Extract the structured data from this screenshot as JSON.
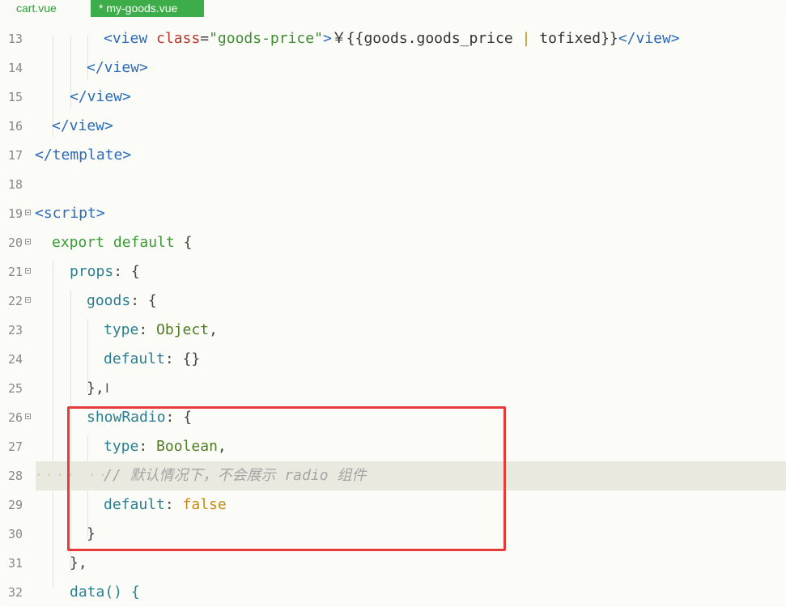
{
  "tabs": [
    {
      "label": "cart.vue",
      "active": false
    },
    {
      "label": "* my-goods.vue",
      "active": true
    }
  ],
  "lines": [
    {
      "num": "13",
      "segments": [
        {
          "t": "<view ",
          "c": "tag"
        },
        {
          "t": "class",
          "c": "attr"
        },
        {
          "t": "=",
          "c": "pun"
        },
        {
          "t": "\"goods-price\"",
          "c": "str"
        },
        {
          "t": ">",
          "c": "tag"
        },
        {
          "t": "￥{{goods.goods_price ",
          "c": "txt"
        },
        {
          "t": "|",
          "c": "val"
        },
        {
          "t": " tofixed}}",
          "c": "txt"
        },
        {
          "t": "</view>",
          "c": "tag"
        }
      ]
    },
    {
      "num": "14",
      "segments": [
        {
          "t": "</view>",
          "c": "tag"
        }
      ]
    },
    {
      "num": "15",
      "segments": [
        {
          "t": "</view>",
          "c": "tag"
        }
      ]
    },
    {
      "num": "16",
      "segments": [
        {
          "t": "</view>",
          "c": "tag"
        }
      ]
    },
    {
      "num": "17",
      "segments": [
        {
          "t": "</template>",
          "c": "tag"
        }
      ]
    },
    {
      "num": "18",
      "segments": []
    },
    {
      "num": "19",
      "segments": [
        {
          "t": "<script>",
          "c": "tag"
        }
      ]
    },
    {
      "num": "20",
      "segments": [
        {
          "t": "export default ",
          "c": "kw"
        },
        {
          "t": "{",
          "c": "pun"
        }
      ]
    },
    {
      "num": "21",
      "segments": [
        {
          "t": "props",
          "c": "prop"
        },
        {
          "t": ": {",
          "c": "pun"
        }
      ]
    },
    {
      "num": "22",
      "segments": [
        {
          "t": "goods",
          "c": "prop"
        },
        {
          "t": ": {",
          "c": "pun"
        }
      ]
    },
    {
      "num": "23",
      "segments": [
        {
          "t": "type",
          "c": "prop"
        },
        {
          "t": ": ",
          "c": "pun"
        },
        {
          "t": "Object",
          "c": "type"
        },
        {
          "t": ",",
          "c": "pun"
        }
      ]
    },
    {
      "num": "24",
      "segments": [
        {
          "t": "default",
          "c": "prop"
        },
        {
          "t": ": {}",
          "c": "pun"
        }
      ]
    },
    {
      "num": "25",
      "segments": [
        {
          "t": "},",
          "c": "pun"
        }
      ]
    },
    {
      "num": "26",
      "segments": [
        {
          "t": "showRadio",
          "c": "prop"
        },
        {
          "t": ": {",
          "c": "pun"
        }
      ]
    },
    {
      "num": "27",
      "segments": [
        {
          "t": "type",
          "c": "prop"
        },
        {
          "t": ": ",
          "c": "pun"
        },
        {
          "t": "Boolean",
          "c": "type"
        },
        {
          "t": ",",
          "c": "pun"
        }
      ]
    },
    {
      "num": "28",
      "segments": [
        {
          "t": "// 默认情况下，不会展示 radio 组件",
          "c": "comment"
        }
      ]
    },
    {
      "num": "29",
      "segments": [
        {
          "t": "default",
          "c": "prop"
        },
        {
          "t": ": ",
          "c": "pun"
        },
        {
          "t": "false",
          "c": "val"
        }
      ]
    },
    {
      "num": "30",
      "segments": [
        {
          "t": "}",
          "c": "pun"
        }
      ]
    },
    {
      "num": "31",
      "segments": [
        {
          "t": "},",
          "c": "pun"
        }
      ]
    },
    {
      "num": "32",
      "segments": [
        {
          "t": "data() {",
          "c": "prop"
        }
      ]
    }
  ],
  "cursor_glyph": "I",
  "whitespace_marker": "····  ··"
}
